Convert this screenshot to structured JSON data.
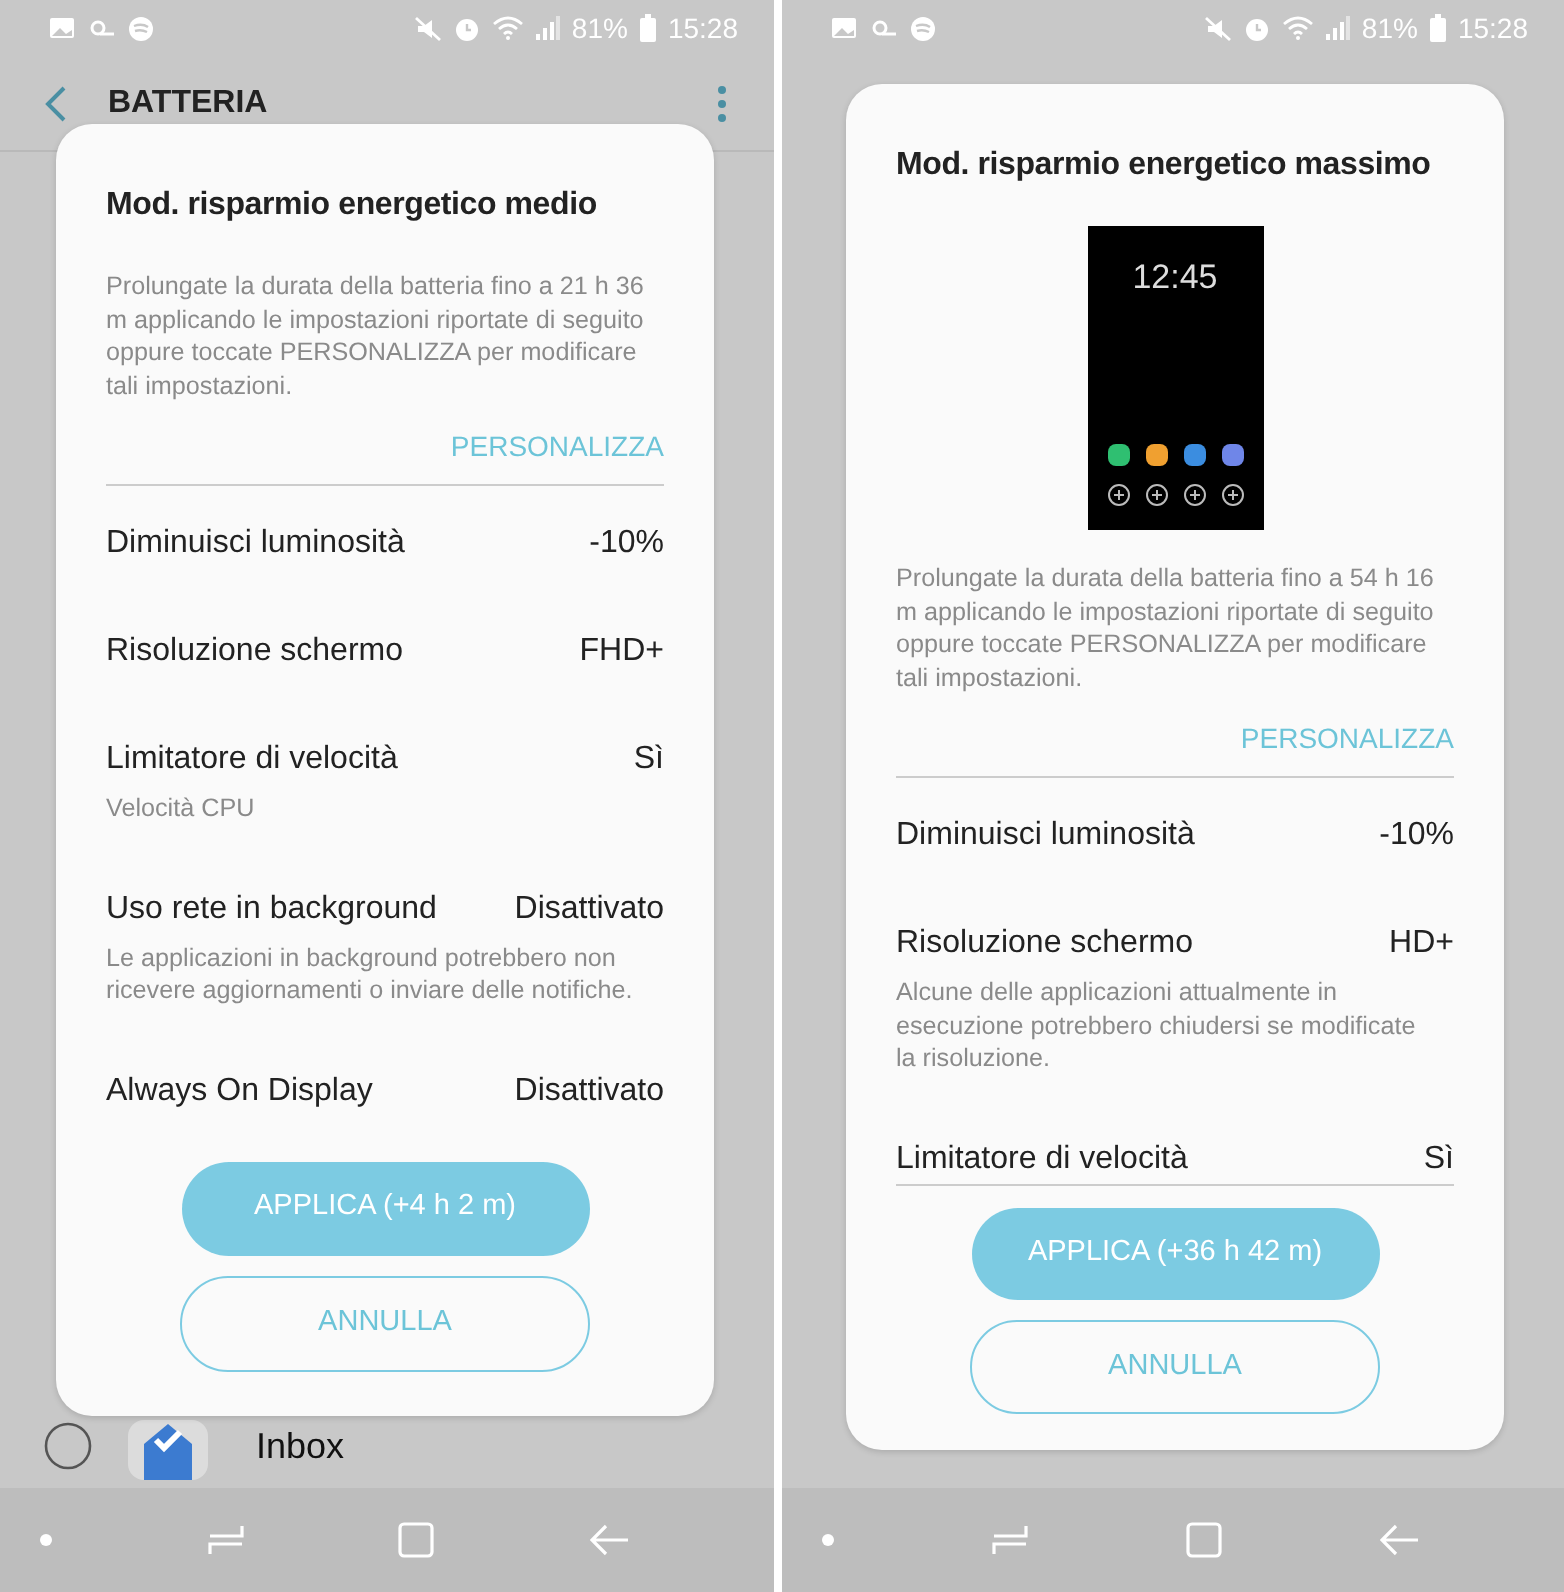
{
  "screens": [
    {
      "status_bar": {
        "battery": "81%",
        "time": "15:28"
      },
      "header": {
        "title": "BATTERIA"
      },
      "background_rows": [
        {
          "name": "Inbox",
          "selected": false
        }
      ],
      "dialog": {
        "title": "Mod. risparmio energetico medio",
        "description": "Prolungate la durata della batteria fino a 21 h 36 m applicando le impostazioni riportate di seguito oppure toccate PERSONALIZZA per modificare tali impostazioni.",
        "customize": "PERSONALIZZA",
        "settings": [
          {
            "label": "Diminuisci luminosità",
            "value": "-10%"
          },
          {
            "label": "Risoluzione schermo",
            "value": "FHD+"
          },
          {
            "label": "Limitatore di velocità",
            "value": "Sì",
            "detail": "Velocità CPU"
          },
          {
            "label": "Uso rete in background",
            "value": "Disattivato",
            "detail": "Le applicazioni in background potrebbero non ricevere aggiornamenti o inviare delle notifiche."
          },
          {
            "label": "Always On Display",
            "value": "Disattivato"
          }
        ],
        "apply": "APPLICA (+4 h 2 m)",
        "cancel": "ANNULLA"
      }
    },
    {
      "status_bar": {
        "battery": "81%",
        "time": "15:28"
      },
      "dialog": {
        "title": "Mod. risparmio energetico massimo",
        "preview": {
          "clock": "12:45"
        },
        "description": "Prolungate la durata della batteria fino a 54 h 16 m applicando le impostazioni riportate di seguito oppure toccate PERSONALIZZA per modificare tali impostazioni.",
        "customize": "PERSONALIZZA",
        "settings": [
          {
            "label": "Diminuisci luminosità",
            "value": "-10%"
          },
          {
            "label": "Risoluzione schermo",
            "value": "HD+",
            "detail": "Alcune delle applicazioni attualmente in esecuzione potrebbero chiudersi se modificate la risoluzione."
          },
          {
            "label": "Limitatore di velocità",
            "value": "Sì"
          }
        ],
        "apply": "APPLICA (+36 h 42 m)",
        "cancel": "ANNULLA"
      }
    }
  ]
}
